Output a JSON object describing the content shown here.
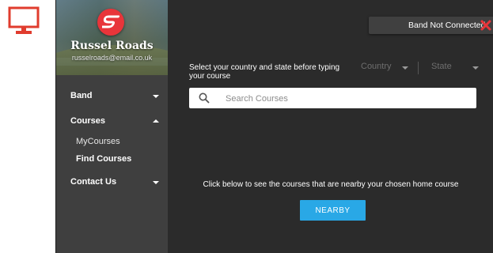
{
  "desktop": {
    "monitor_icon": "monitor-icon",
    "monitor_color": "#e03c2e"
  },
  "profile": {
    "name": "Russel Roads",
    "email": "russelroads@email.co.uk",
    "logo_icon": "brand-s-logo-icon",
    "logo_color": "#e8353a"
  },
  "sidebar": {
    "items": [
      {
        "label": "Band",
        "expanded": false
      },
      {
        "label": "Courses",
        "expanded": true,
        "children": [
          {
            "label": "MyCourses"
          },
          {
            "label": "Find Courses",
            "active": true
          }
        ]
      },
      {
        "label": "Contact Us",
        "expanded": false
      }
    ]
  },
  "status": {
    "text": "Band Not Connected",
    "icon": "close-x-icon",
    "icon_color": "#e8353a"
  },
  "filters": {
    "instruction": "Select your country and state before typing your course",
    "country_label": "Country",
    "state_label": "State"
  },
  "search": {
    "placeholder": "Search Courses",
    "value": ""
  },
  "nearby": {
    "text": "Click below to see the courses that are nearby your chosen home course",
    "button_label": "NEARBY",
    "button_color": "#29a8e6"
  }
}
